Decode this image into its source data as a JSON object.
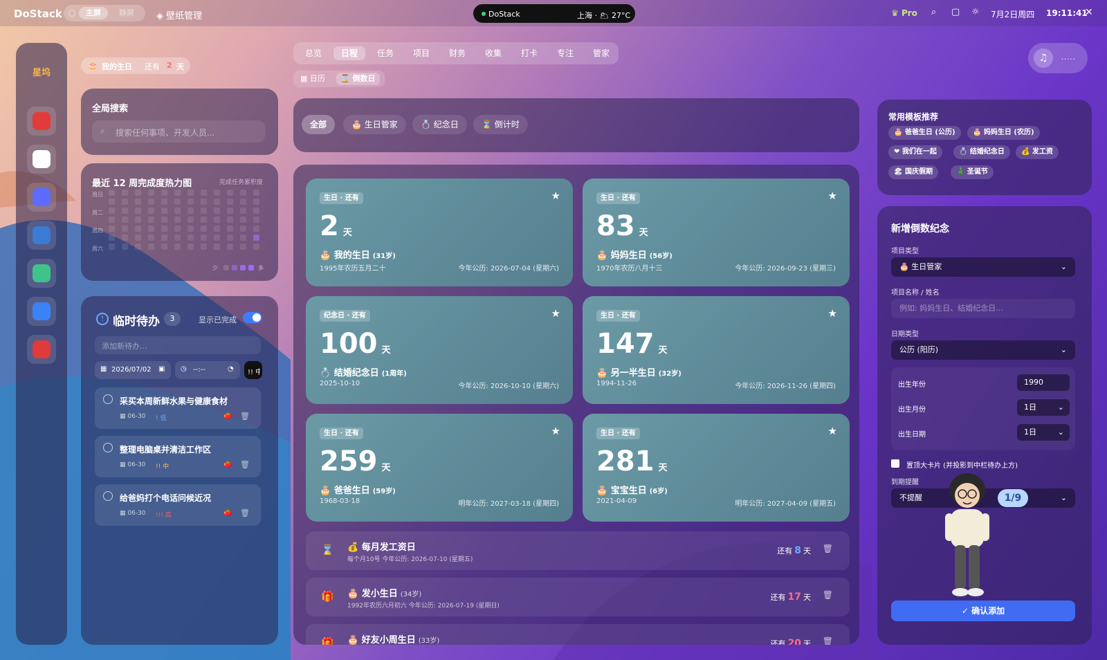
{
  "app": {
    "name": "DoStack",
    "mode_active": "主屏",
    "mode_inactive": "静屏",
    "wallpaper_label": "壁纸管理"
  },
  "island": {
    "app": "DoStack",
    "weather": "上海 · 🌥 27°C"
  },
  "topbar": {
    "pro": "Pro",
    "date": "7月2日周四",
    "time": "19:11:41",
    "close": "✕"
  },
  "dock": {
    "title": "星坞",
    "apps": [
      {
        "name": "netease-music",
        "color": "#e33b3b"
      },
      {
        "name": "assistant-app",
        "color": "#ffffff"
      },
      {
        "name": "camera-app",
        "color": "#5b6cff"
      },
      {
        "name": "v-app",
        "color": "#3a7bd5"
      },
      {
        "name": "map-app",
        "color": "#3ec38a"
      },
      {
        "name": "a-app",
        "color": "#3b82f6"
      },
      {
        "name": "record-app",
        "color": "#e03a3a"
      }
    ]
  },
  "birthday_pill": {
    "icon": "🎂",
    "label": "我的生日",
    "prefix": "还有",
    "days": "2",
    "unit": "天"
  },
  "search": {
    "title": "全局搜索",
    "placeholder": "搜索任何事项、开发人员..."
  },
  "heatmap": {
    "title": "最近 12 周完成度热力图",
    "subtitle": "完成任务累积度",
    "days": [
      "周日",
      "周二",
      "周四",
      "周六"
    ],
    "legend_low": "少",
    "legend_high": "多"
  },
  "todo": {
    "title": "临时待办",
    "count": "3",
    "show_done": "显示已完成",
    "input_placeholder": "添加新待办...",
    "date": "2026/07/02",
    "time": "--:--",
    "priority": "!! 中",
    "items": [
      {
        "text": "采买本周新鲜水果与健康食材",
        "date": "06-30",
        "priority": "! 低",
        "pcolor": "#6ea8ff"
      },
      {
        "text": "整理电脑桌并清洁工作区",
        "date": "06-30",
        "priority": "!! 中",
        "pcolor": "#ffb84d"
      },
      {
        "text": "给爸妈打个电话问候近况",
        "date": "06-30",
        "priority": "!!! 高",
        "pcolor": "#ff5a5a"
      }
    ]
  },
  "tabs": [
    "总览",
    "日程",
    "任务",
    "项目",
    "财务",
    "收集",
    "打卡",
    "专注",
    "管家"
  ],
  "active_tab": "日程",
  "subtabs": [
    "日历",
    "倒数日"
  ],
  "filters": [
    "全部",
    "🎂 生日管家",
    "💍 纪念日",
    "⌛ 倒计时"
  ],
  "cards": [
    {
      "tag": "生日 · 还有",
      "days": "2",
      "unit": "天",
      "icon": "🎂",
      "name": "我的生日",
      "age": "(31岁)",
      "orig": "1995年农历五月二十",
      "next": "今年公历: 2026-07-04 (星期六)"
    },
    {
      "tag": "生日 · 还有",
      "days": "83",
      "unit": "天",
      "icon": "🎂",
      "name": "妈妈生日",
      "age": "(56岁)",
      "orig": "1970年农历八月十三",
      "next": "今年公历: 2026-09-23 (星期三)"
    },
    {
      "tag": "纪念日 · 还有",
      "days": "100",
      "unit": "天",
      "icon": "💍",
      "name": "结婚纪念日",
      "age": "(1周年)",
      "orig": "2025-10-10",
      "next": "今年公历: 2026-10-10 (星期六)"
    },
    {
      "tag": "生日 · 还有",
      "days": "147",
      "unit": "天",
      "icon": "🎂",
      "name": "另一半生日",
      "age": "(32岁)",
      "orig": "1994-11-26",
      "next": "今年公历: 2026-11-26 (星期四)"
    },
    {
      "tag": "生日 · 还有",
      "days": "259",
      "unit": "天",
      "icon": "🎂",
      "name": "爸爸生日",
      "age": "(59岁)",
      "orig": "1968-03-18",
      "next": "明年公历: 2027-03-18 (星期四)"
    },
    {
      "tag": "生日 · 还有",
      "days": "281",
      "unit": "天",
      "icon": "🎂",
      "name": "宝宝生日",
      "age": "(6岁)",
      "orig": "2021-04-09",
      "next": "明年公历: 2027-04-09 (星期五)"
    }
  ],
  "rows": [
    {
      "icon": "⌛",
      "emoji": "💰",
      "title": "每月发工资日",
      "age": "",
      "sub": "每个月10号   今年公历: 2026-07-10 (星期五)",
      "prefix": "还有",
      "days": "8",
      "unit": "天",
      "dcolor": "#6ea8ff"
    },
    {
      "icon": "🎁",
      "emoji": "🎂",
      "title": "发小生日",
      "age": "(34岁)",
      "sub": "1992年农历六月初六   今年公历: 2026-07-19 (星期日)",
      "prefix": "还有",
      "days": "17",
      "unit": "天",
      "dcolor": "#ff6b8a"
    },
    {
      "icon": "🎁",
      "emoji": "🎂",
      "title": "好友小周生日",
      "age": "(33岁)",
      "sub": "",
      "prefix": "还有",
      "days": "20",
      "unit": "天",
      "dcolor": "#ff6b8a"
    }
  ],
  "templates": {
    "title": "常用模板推荐",
    "items": [
      "🎂 爸爸生日 (公历)",
      "🎂 妈妈生日 (农历)",
      "❤ 我们在一起",
      "💍 结婚纪念日",
      "💰 发工资",
      "🏖 国庆假期",
      "🎄 圣诞节"
    ]
  },
  "form": {
    "title": "新增倒数纪念",
    "type_label": "项目类型",
    "type_value": "🎂 生日管家",
    "name_label": "项目名称 / 姓名",
    "name_placeholder": "例如: 妈妈生日、结婚纪念日...",
    "date_type_label": "日期类型",
    "date_type_value": "公历 (阳历)",
    "year_label": "出生年份",
    "year_value": "1990",
    "month_label": "出生月份",
    "month_value": "1日",
    "day_label": "出生日期",
    "day_value": "1日",
    "pin_label": "置顶大卡片 (并投影到中栏待办上方)",
    "remind_label": "到期提醒",
    "remind_value": "不提醒",
    "submit": "✓ 确认添加"
  },
  "mascot_badge": "1/9"
}
